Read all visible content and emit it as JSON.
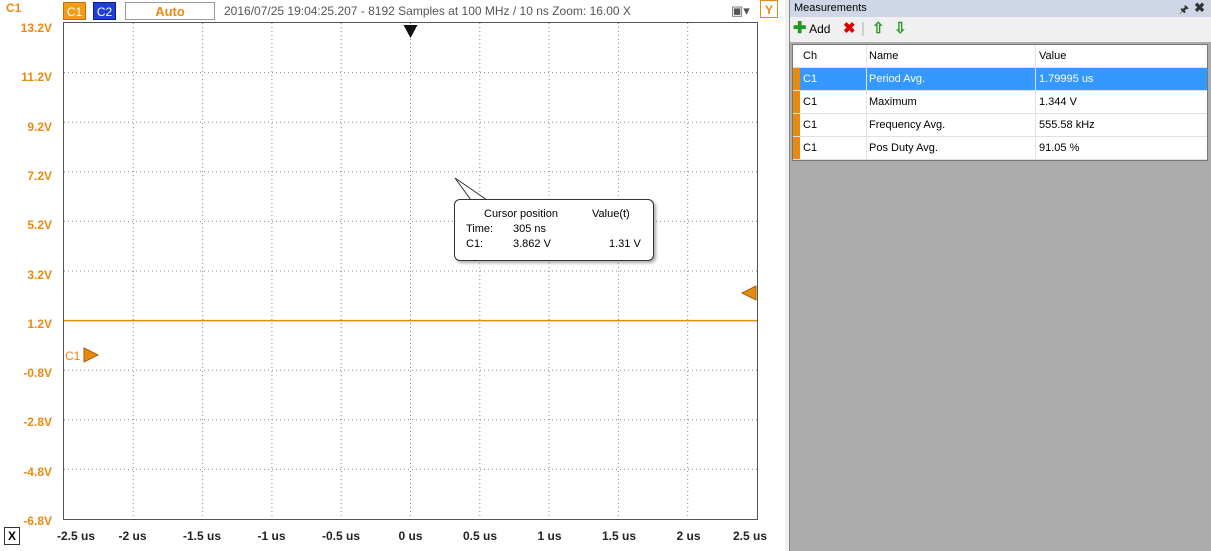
{
  "toolbar": {
    "channel_label": "C1",
    "c1_button": "C1",
    "c2_button": "C2",
    "trigger_mode": "Auto",
    "status": "2016/07/25 19:04:25.207 - 8192 Samples at 100 MHz / 10 ns Zoom: 16.00 X",
    "y_button": "Y",
    "x_button": "X"
  },
  "plot": {
    "y_ticks": [
      "13.2V",
      "11.2V",
      "9.2V",
      "7.2V",
      "5.2V",
      "3.2V",
      "1.2V",
      "-0.8V",
      "-2.8V",
      "-4.8V",
      "-6.8V"
    ],
    "x_ticks": [
      "-2.5 us",
      "-2 us",
      "-1.5 us",
      "-1 us",
      "-0.5 us",
      "0 us",
      "0.5 us",
      "1 us",
      "1.5 us",
      "2 us",
      "2.5 us"
    ],
    "channel_marker": "C1",
    "signal_level_v": 1.2,
    "colors": {
      "c1": "#e88a12",
      "c2": "#1f3fd6",
      "grid": "#888888"
    }
  },
  "tooltip": {
    "header_pos": "Cursor position",
    "header_val": "Value(t)",
    "time_label": "Time:",
    "time_value": "305 ns",
    "c1_label": "C1:",
    "c1_pos": "3.862 V",
    "c1_val": "1.31 V"
  },
  "measurements": {
    "title": "Measurements",
    "add_label": "Add",
    "columns": {
      "ch": "Ch",
      "name": "Name",
      "value": "Value"
    },
    "rows": [
      {
        "ch": "C1",
        "name": "Period Avg.",
        "value": "1.79995 us",
        "selected": true
      },
      {
        "ch": "C1",
        "name": "Maximum",
        "value": "1.344 V",
        "selected": false
      },
      {
        "ch": "C1",
        "name": "Frequency Avg.",
        "value": "555.58 kHz",
        "selected": false
      },
      {
        "ch": "C1",
        "name": "Pos Duty Avg.",
        "value": "91.05 %",
        "selected": false
      }
    ]
  }
}
